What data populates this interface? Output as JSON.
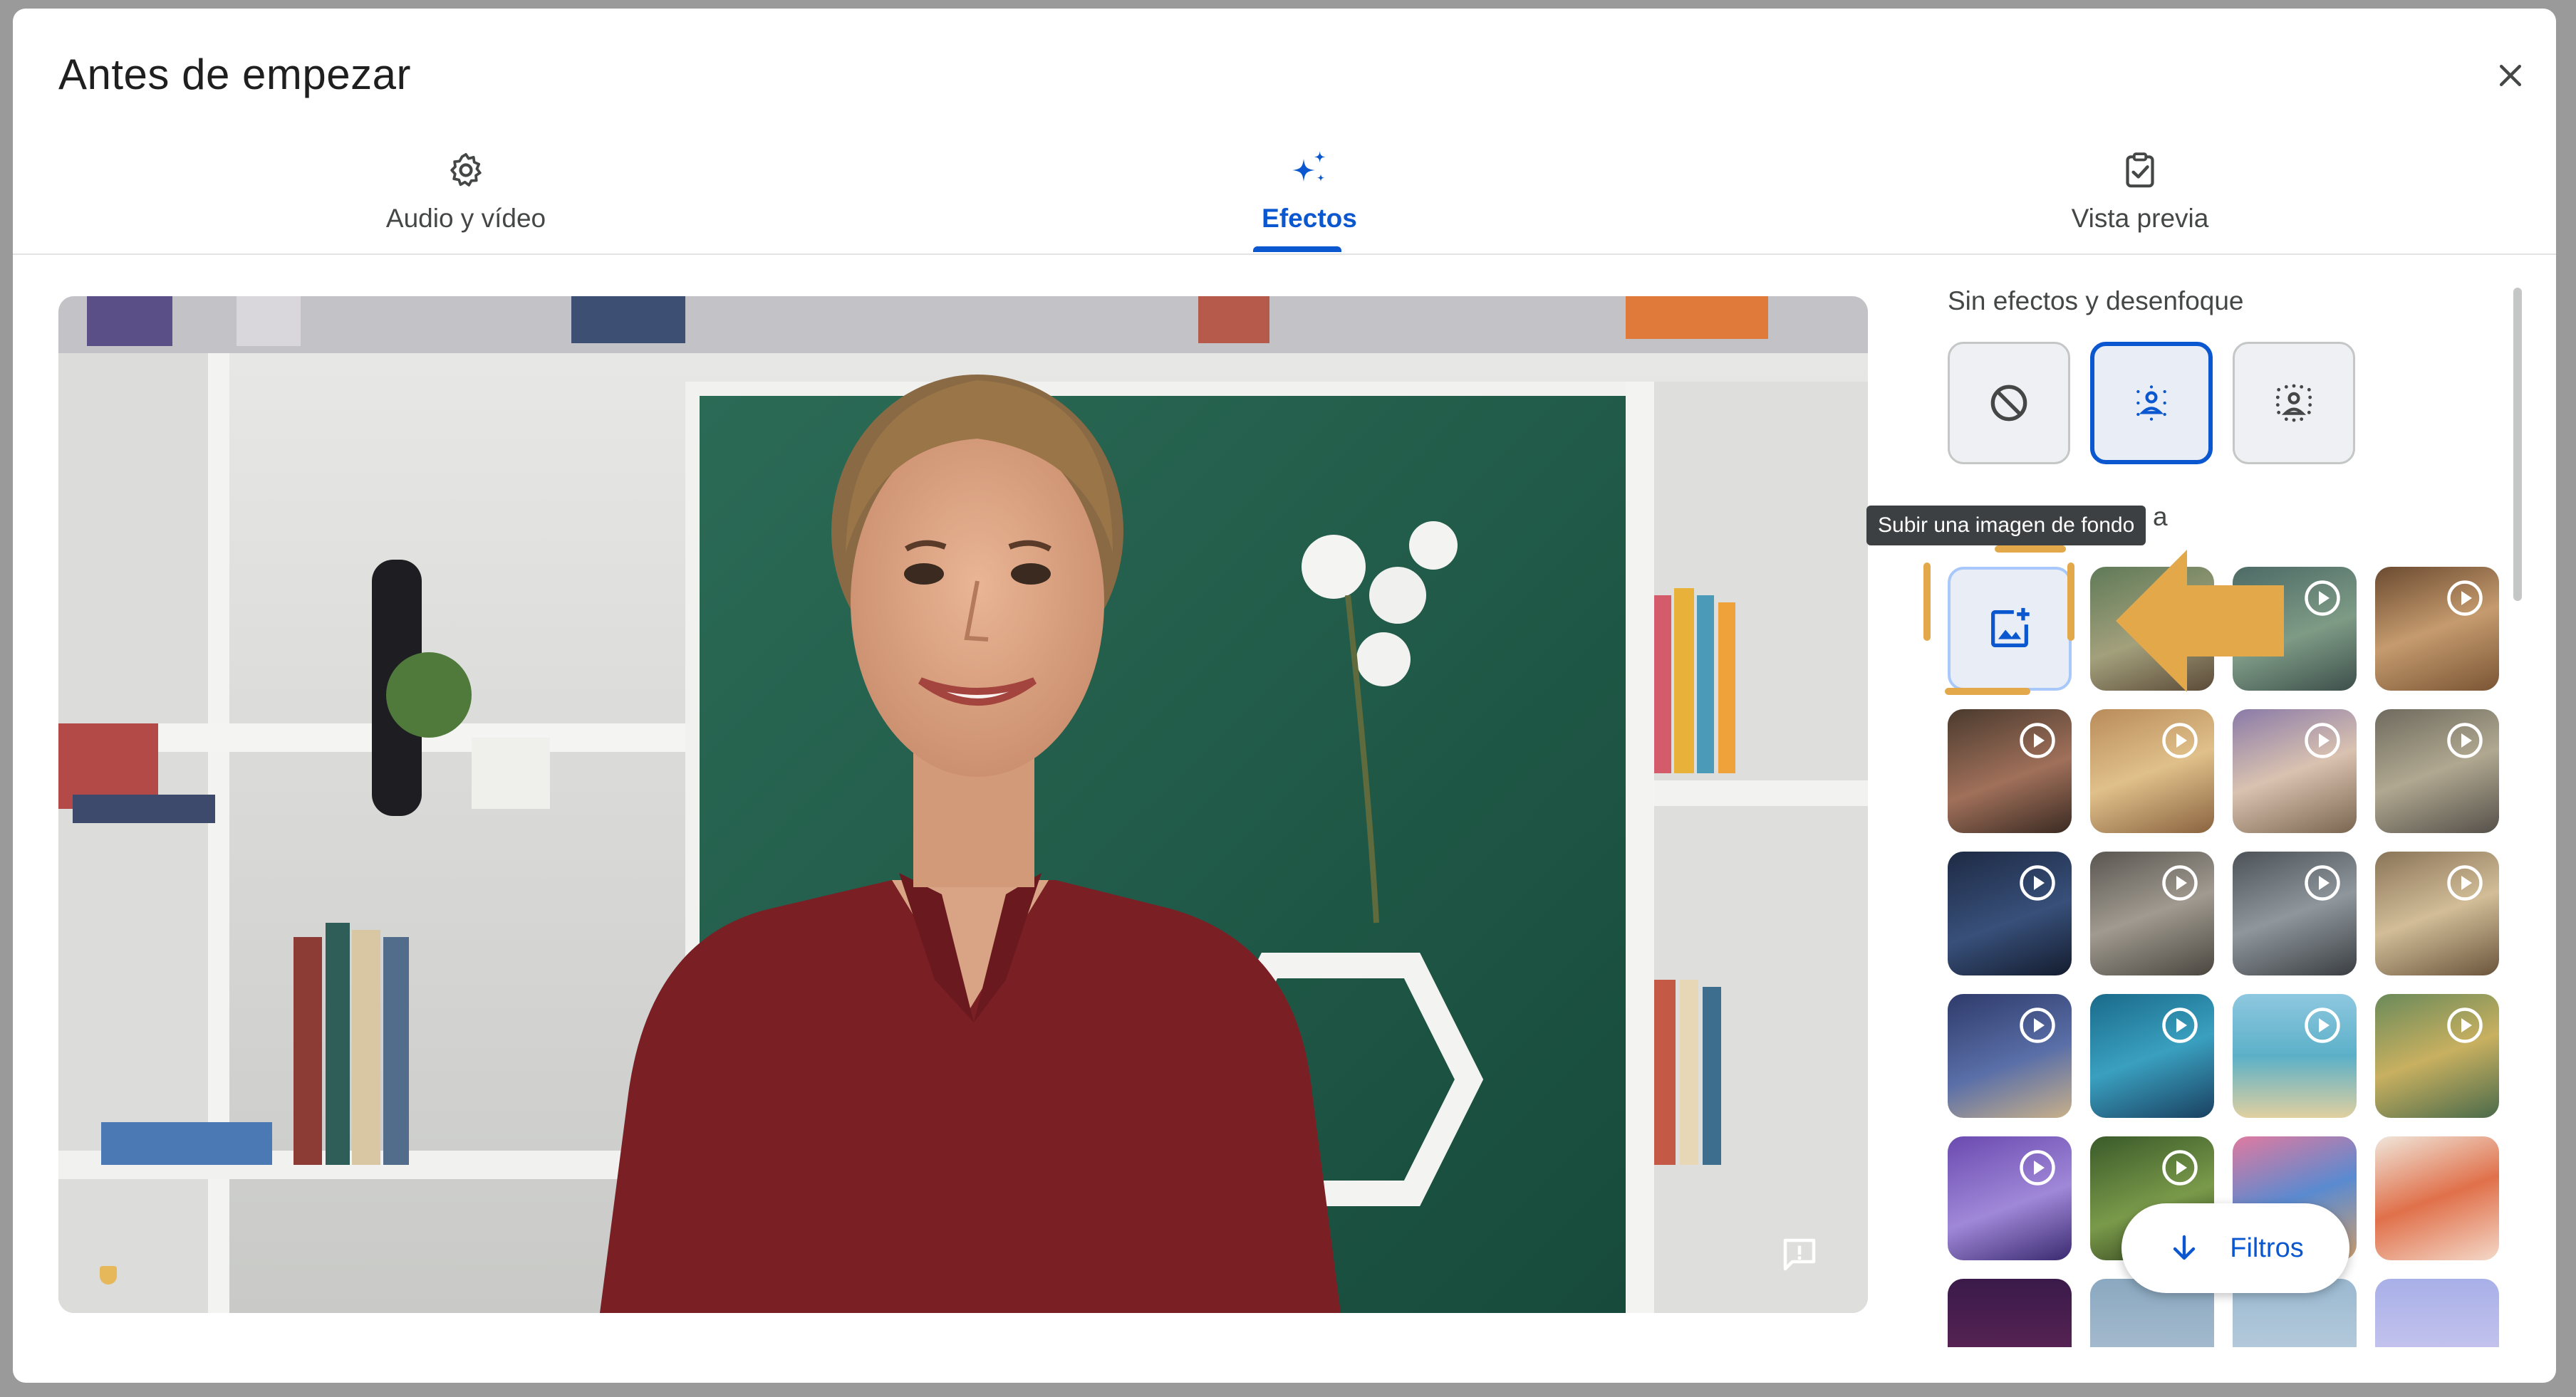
{
  "dialog": {
    "title": "Antes de empezar"
  },
  "tabs": [
    {
      "label": "Audio y vídeo",
      "icon": "gear-icon"
    },
    {
      "label": "Efectos",
      "icon": "sparkle-icon",
      "active": true
    },
    {
      "label": "Vista previa",
      "icon": "clipboard-check-icon"
    }
  ],
  "effects_panel": {
    "section_title": "Sin efectos y desenfoque",
    "effects": [
      {
        "name": "no-effect",
        "icon": "block-icon"
      },
      {
        "name": "slight-blur",
        "icon": "person-blur-icon",
        "selected": true
      },
      {
        "name": "blur",
        "icon": "person-blur-strong-icon"
      }
    ],
    "tooltip": "Subir una imagen de fondo",
    "partially_hidden_text": "a",
    "filters_button": "Filtros"
  },
  "colors": {
    "accent": "#0b57d0",
    "highlight": "#e2a84a",
    "shirt": "#7a1f24",
    "wall": "#1f5a48"
  }
}
